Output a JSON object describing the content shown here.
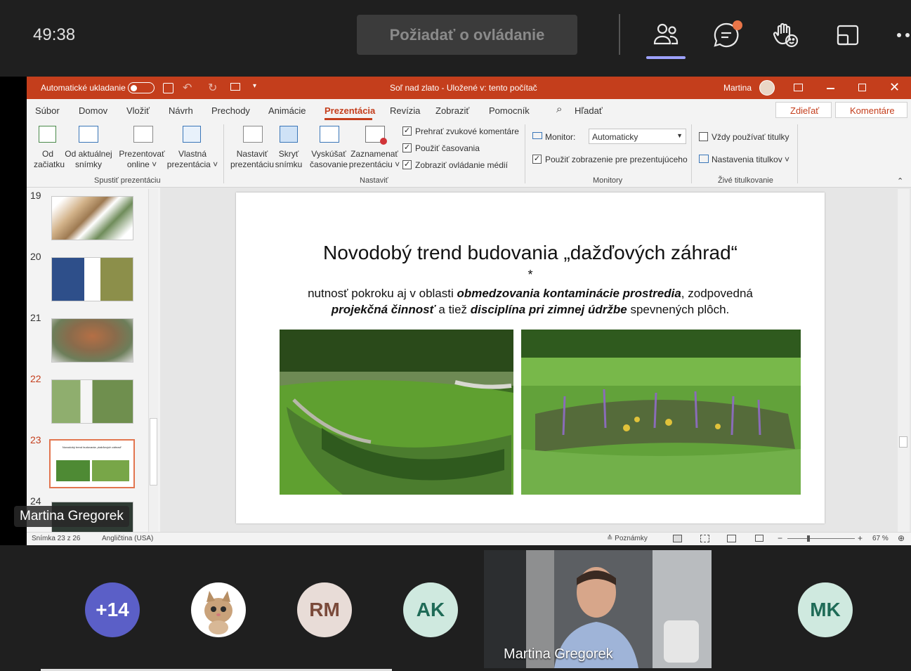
{
  "meeting": {
    "timer": "49:38",
    "request_control": "Požiadať o ovládanie",
    "icons": [
      "people-icon",
      "chat-icon",
      "raise-hand-icon",
      "share-tray-icon",
      "more-icon"
    ]
  },
  "ppt": {
    "autosave_label": "Automatické ukladanie",
    "doc_title": "Soľ nad zlato - Uložené v: tento počítač",
    "user": "Martina",
    "tabs": [
      "Súbor",
      "Domov",
      "Vložiť",
      "Návrh",
      "Prechody",
      "Animácie",
      "Prezentácia",
      "Revízia",
      "Zobraziť",
      "Pomocník"
    ],
    "active_tab": "Prezentácia",
    "search": "Hľadať",
    "share": "Zdieľať",
    "comments": "Komentáre",
    "ribbon": {
      "od_zaciatku": [
        "Od",
        "začiatku"
      ],
      "od_aktualnej": [
        "Od aktuálnej",
        "snímky"
      ],
      "online": [
        "Prezentovať",
        "online ˅"
      ],
      "vlastna": [
        "Vlastná",
        "prezentácia ˅"
      ],
      "group1": "Spustiť prezentáciu",
      "nastavit": [
        "Nastaviť",
        "prezentáciu"
      ],
      "skryt": [
        "Skryť",
        "snímku"
      ],
      "vyskusat": [
        "Vyskúšať",
        "časovanie"
      ],
      "zaznamenat": [
        "Zaznamenať",
        "prezentáciu ˅"
      ],
      "check1": "Prehrať zvukové komentáre",
      "check2": "Použiť časovania",
      "check3": "Zobraziť ovládanie médií",
      "group2": "Nastaviť",
      "monitor_label": "Monitor:",
      "monitor_value": "Automaticky",
      "presenter_view": "Použiť zobrazenie pre prezentujúceho",
      "group3": "Monitory",
      "always_subtitles": "Vždy používať titulky",
      "subtitle_settings": "Nastavenia titulkov ˅",
      "group4": "Živé titulkovanie"
    },
    "slide_numbers": [
      "19",
      "20",
      "21",
      "22",
      "23",
      "24"
    ],
    "current_slide": "23",
    "slide": {
      "title": "Novodobý trend budovania „dažďových záhrad“",
      "star": "*",
      "body_1": "nutnosť pokroku aj v oblasti ",
      "body_2": "obmedzovania kontaminácie prostredia",
      "body_3": ", zodpovedná ",
      "body_4": "projekčná činnosť",
      "body_5": " a tiež ",
      "body_6": "disciplína pri zimnej údržbe",
      "body_7": " spevnených plôch."
    },
    "status": {
      "slide_count": "Snímka 23 z 26",
      "language": "Angličtina (USA)",
      "notes": "Poznámky",
      "zoom": "67 %"
    }
  },
  "presenter_label": "Martina Gregorek",
  "participants": {
    "more": "+14",
    "rm": "RM",
    "ak": "AK",
    "mk": "MK",
    "video_name": "Martina Gregorek"
  },
  "colors": {
    "ppt_accent": "#c43e1c",
    "more_bg": "#5b5fc7",
    "rm_bg": "#e8dcd7",
    "ak_bg": "#cfe9df",
    "mk_bg": "#cfe9df"
  }
}
